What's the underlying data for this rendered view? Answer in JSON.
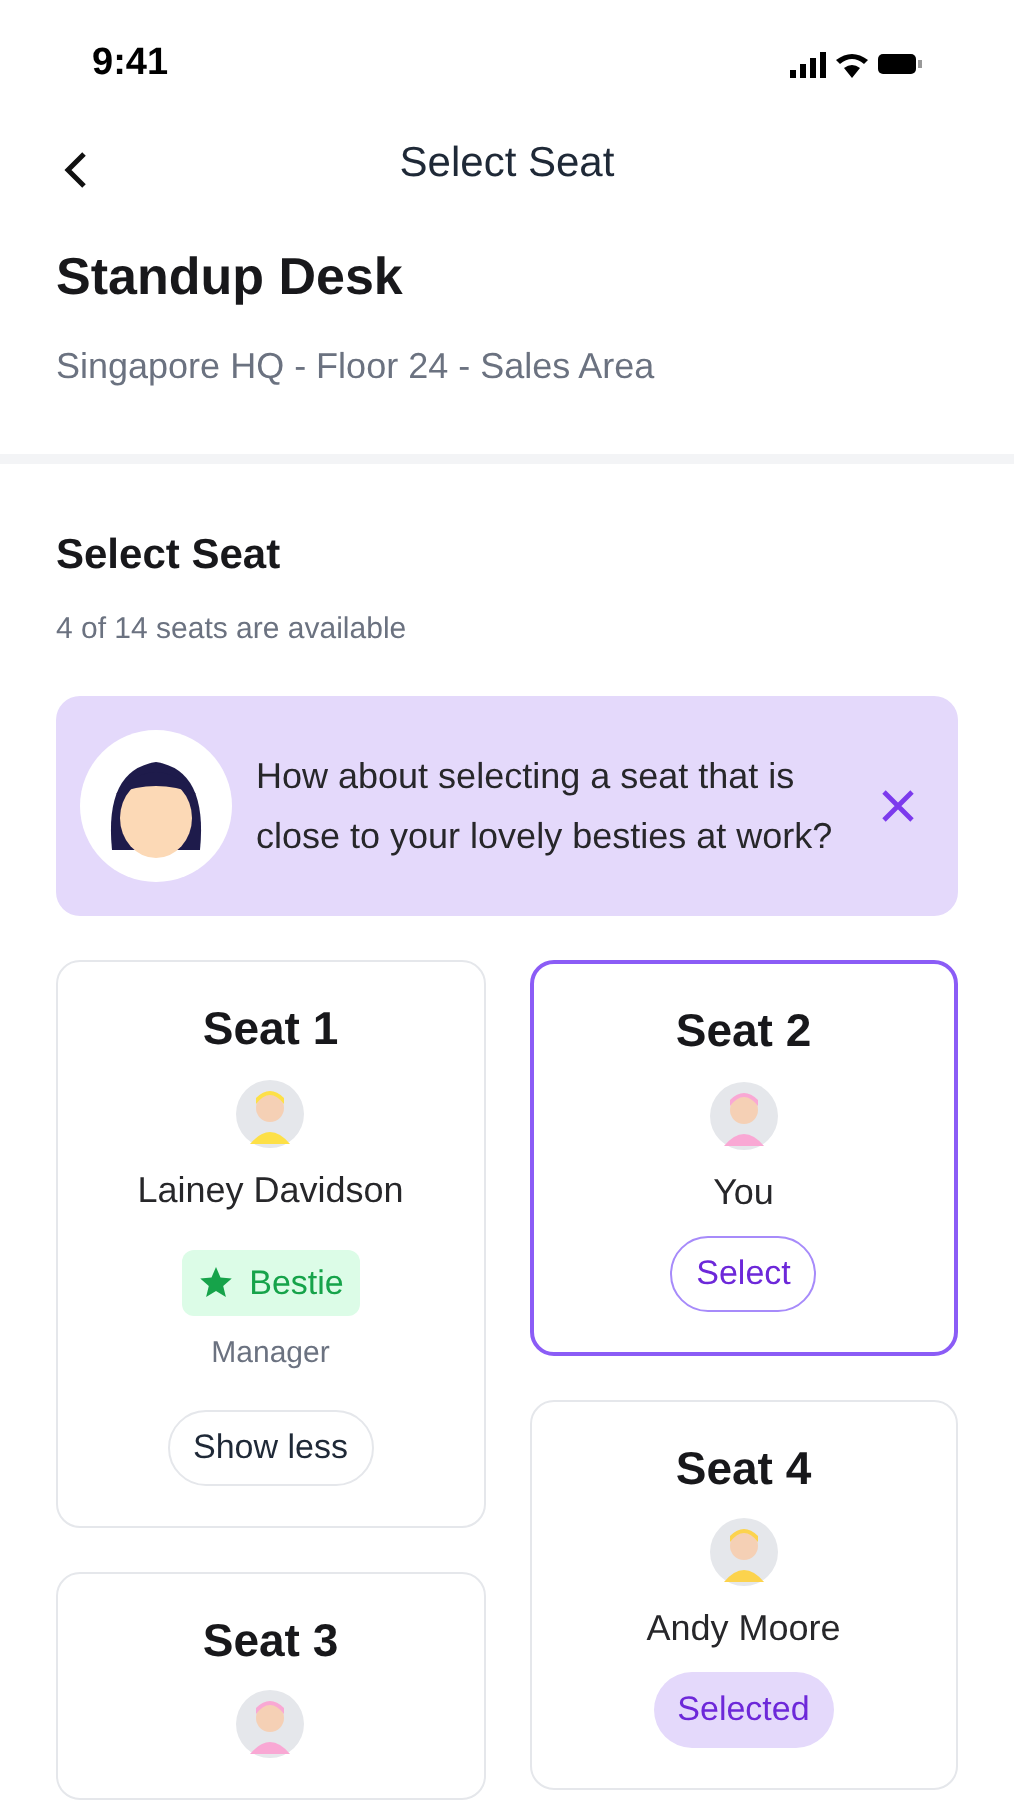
{
  "status_bar": {
    "time": "9:41"
  },
  "nav": {
    "title": "Select Seat"
  },
  "desk": {
    "title": "Standup Desk",
    "location": "Singapore HQ - Floor 24 - Sales Area"
  },
  "section": {
    "title": "Select Seat",
    "subtitle": "4 of 14 seats are available"
  },
  "tip": {
    "text": "How about selecting a seat that is close to your lovely besties at work?"
  },
  "columns": [
    {
      "seats": [
        {
          "title": "Seat 1",
          "selected": false,
          "name": "Lainey Davidson",
          "badge": "Bestie",
          "role": "Manager",
          "action": {
            "label": "Show less",
            "kind": "plain"
          }
        },
        {
          "title": "Seat 3",
          "selected": false
        }
      ]
    },
    {
      "seats": [
        {
          "title": "Seat 2",
          "selected": true,
          "name": "You",
          "action": {
            "label": "Select",
            "kind": "outline"
          }
        },
        {
          "title": "Seat 4",
          "selected": false,
          "name": "Andy Moore",
          "action": {
            "label": "Selected",
            "kind": "filled"
          }
        }
      ]
    }
  ]
}
